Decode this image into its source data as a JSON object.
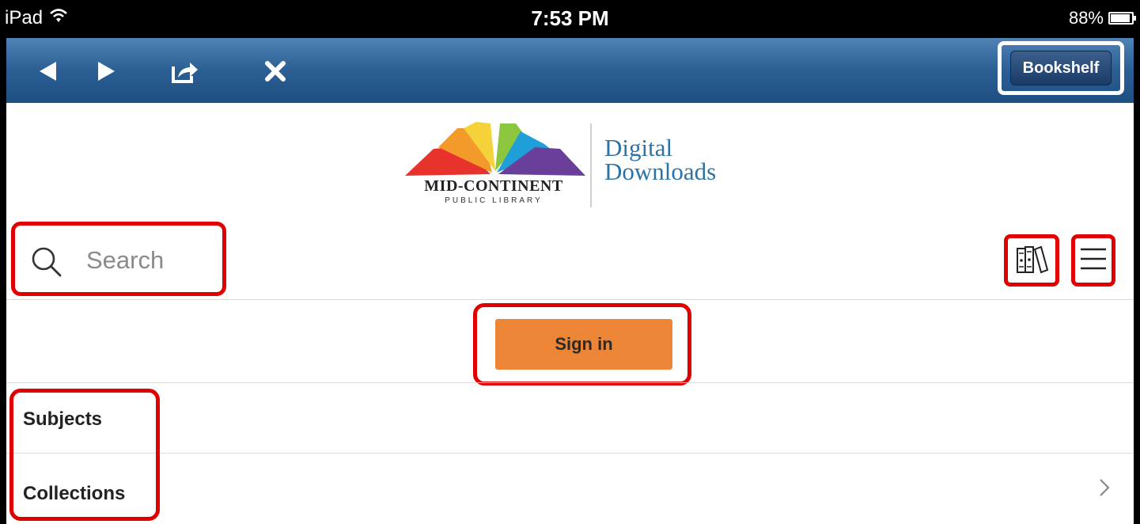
{
  "status_bar": {
    "device": "iPad",
    "time": "7:53 PM",
    "battery": "88%"
  },
  "toolbar": {
    "icons": [
      "back-arrow-icon",
      "forward-arrow-icon",
      "share-icon",
      "close-icon"
    ],
    "bookshelf_label": "Bookshelf"
  },
  "logo": {
    "brand_line1": "MID-CONTINENT",
    "brand_line2": "PUBLIC LIBRARY",
    "product_line1": "Digital",
    "product_line2": "Downloads",
    "colors": [
      "#e8322c",
      "#f29b2b",
      "#f6d23a",
      "#8cc63f",
      "#1f9fd8",
      "#6a3f99"
    ]
  },
  "search": {
    "placeholder": "Search",
    "value": ""
  },
  "header_icons": [
    "bookshelf-books-icon",
    "menu-hamburger-icon"
  ],
  "sign_in": {
    "label": "Sign in",
    "color": "#ec8636"
  },
  "menu": {
    "items": [
      {
        "label": "Subjects"
      },
      {
        "label": "Collections"
      }
    ]
  },
  "highlight_color": "#e00000"
}
